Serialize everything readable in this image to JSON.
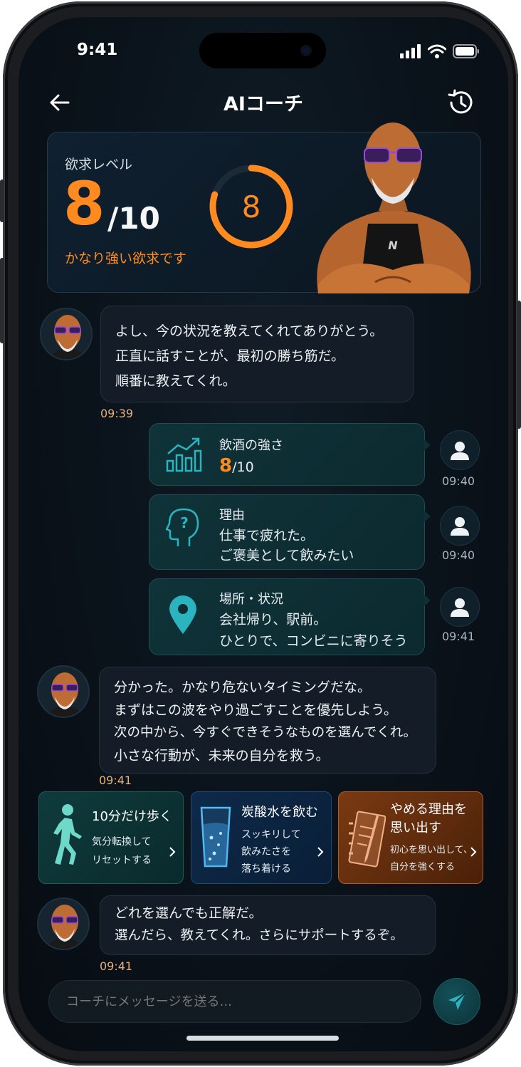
{
  "status": {
    "time": "9:41"
  },
  "header": {
    "title": "AIコーチ"
  },
  "level_card": {
    "label": "欲求レベル",
    "value": "8",
    "denominator": "/10",
    "ring_value": "8",
    "level_fraction": 0.8,
    "description": "かなり強い欲求です"
  },
  "messages": {
    "coach1": {
      "lines": [
        "よし、今の状況を教えてくれてありがとう。",
        "正直に話すことが、最初の勝ち筋だ。",
        "順番に教えてくれ。"
      ],
      "time": "09:39"
    },
    "user1": {
      "title": "飲酒の強さ",
      "value": "8",
      "denominator": "/10",
      "time": "09:40"
    },
    "user2": {
      "title": "理由",
      "lines": [
        "仕事で疲れた。",
        "ご褒美として飲みたい"
      ],
      "time": "09:40"
    },
    "user3": {
      "title": "場所・状況",
      "lines": [
        "会社帰り、駅前。",
        "ひとりで、コンビニに寄りそう"
      ],
      "time": "09:41"
    },
    "coach2": {
      "lines": [
        "分かった。かなり危ないタイミングだな。",
        "まずはこの波をやり過ごすことを優先しよう。",
        "次の中から、今すぐできそうなものを選んでくれ。",
        "小さな行動が、未来の自分を救う。"
      ],
      "time": "09:41"
    },
    "coach3": {
      "lines": [
        "どれを選んでも正解だ。",
        "選んだら、教えてくれ。さらにサポートするぞ。"
      ],
      "time": "09:41"
    }
  },
  "actions": [
    {
      "title": "10分だけ歩く",
      "sub": [
        "気分転換して",
        "リセットする"
      ],
      "icon": "walking-person-icon"
    },
    {
      "title": "炭酸水を飲む",
      "sub": [
        "スッキリして",
        "飲みたさを",
        "落ち着ける"
      ],
      "icon": "glass-icon"
    },
    {
      "title": [
        "やめる理由を",
        "思い出す"
      ],
      "sub": [
        "初心を思い出して、",
        "自分を強くする"
      ],
      "icon": "notebook-icon"
    }
  ],
  "composer": {
    "placeholder": "コーチにメッセージを送る..."
  },
  "colors": {
    "accent_orange": "#ff8a1f",
    "teal": "#2bb3c0",
    "background": "#0a121a"
  }
}
